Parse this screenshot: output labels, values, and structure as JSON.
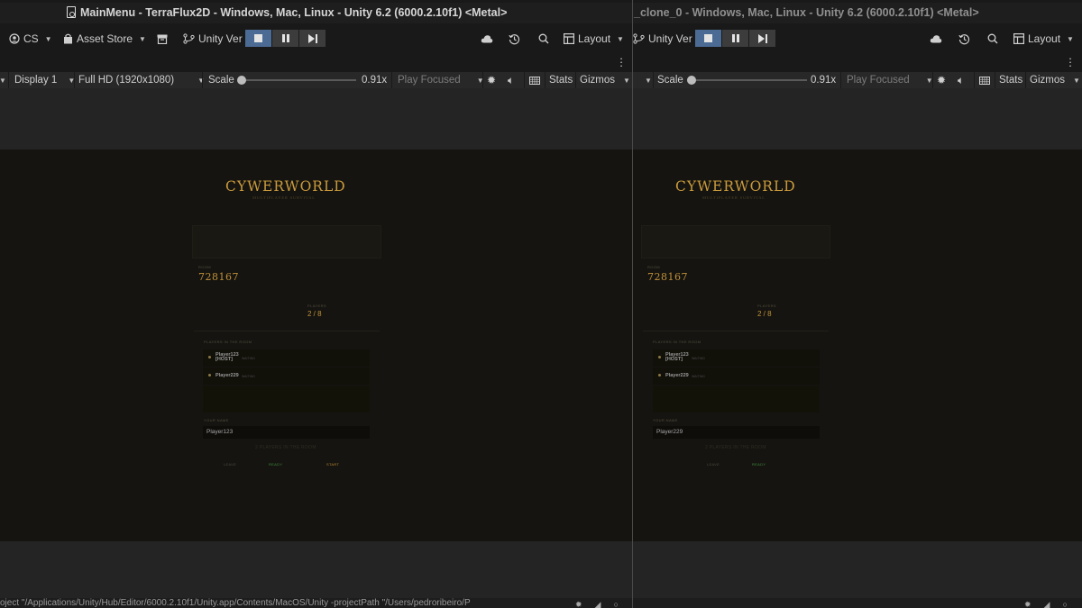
{
  "left_window": {
    "title": "MainMenu - TerraFlux2D - Windows, Mac, Linux - Unity 6.2 (6000.2.10f1) <Metal>",
    "account_label": "CS",
    "asset_store_label": "Asset Store",
    "version_control_label": "Unity Ver",
    "layout_label": "Layout",
    "display_label": "Display 1",
    "resolution_label": "Full HD (1920x1080)",
    "scale_label": "Scale",
    "scale_value": "0.91x",
    "play_mode_label": "Play Focused",
    "stats_label": "Stats",
    "gizmos_label": "Gizmos",
    "status_text": "oject \"/Applications/Unity/Hub/Editor/6000.2.10f1/Unity.app/Contents/MacOS/Unity -projectPath \"/Users/pedroribeiro/P"
  },
  "right_window": {
    "title": "_clone_0 - Windows, Mac, Linux - Unity 6.2 (6000.2.10f1) <Metal>",
    "version_control_label": "Unity Ver",
    "layout_label": "Layout",
    "scale_label": "Scale",
    "scale_value": "0.91x",
    "play_mode_label": "Play Focused",
    "stats_label": "Stats",
    "gizmos_label": "Gizmos"
  },
  "game_left": {
    "title": "CYWERWORLD",
    "subtitle": "MULTIPLAYER SURVIVAL",
    "room_label": "ROOM",
    "room_code": "728167",
    "players_label": "PLAYERS",
    "players_count": "2 / 8",
    "players_in_room_label": "PLAYERS IN THE ROOM",
    "players": [
      {
        "name": "Player123",
        "tag": "[HOST]",
        "status": "WAITING"
      },
      {
        "name": "Player229",
        "tag": "",
        "status": "WAITING"
      }
    ],
    "your_name_label": "YOUR NAME",
    "your_name_value": "Player123",
    "hint": "2 PLAYERS IN THE ROOM",
    "leave_label": "LEAVE",
    "ready_label": "READY",
    "start_label": "START"
  },
  "game_right": {
    "title": "CYWERWORLD",
    "subtitle": "MULTIPLAYER SURVIVAL",
    "room_label": "ROOM",
    "room_code": "728167",
    "players_label": "PLAYERS",
    "players_count": "2 / 8",
    "players_in_room_label": "PLAYERS IN THE ROOM",
    "players": [
      {
        "name": "Player123",
        "tag": "[HOST]",
        "status": "WAITING"
      },
      {
        "name": "Player229",
        "tag": "",
        "status": "WAITING"
      }
    ],
    "your_name_label": "YOUR NAME",
    "your_name_value": "Player229",
    "hint": "2 PLAYERS IN THE ROOM",
    "leave_label": "LEAVE",
    "ready_label": "READY"
  },
  "colors": {
    "accent_gold": "#c99a3c",
    "play_active": "#4c6b94",
    "ready_green": "#3f8a3a",
    "start_gold": "#b8862f"
  }
}
